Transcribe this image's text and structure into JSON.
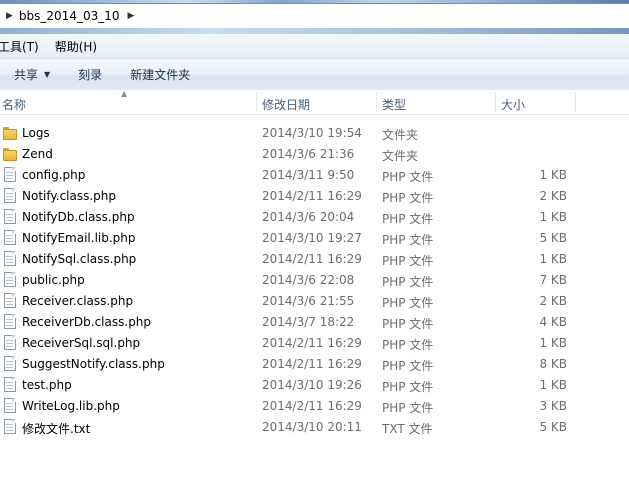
{
  "address": {
    "path": [
      "bbs_2014_03_10"
    ]
  },
  "menu": {
    "items": [
      "工具(T)",
      "帮助(H)"
    ]
  },
  "toolbar": {
    "share": "共享",
    "burn": "刻录",
    "new_folder": "新建文件夹"
  },
  "columns": {
    "name": "名称",
    "date": "修改日期",
    "type": "类型",
    "size": "大小"
  },
  "files": [
    {
      "icon": "folder-icon",
      "name": "Logs",
      "date": "2014/3/10 19:54",
      "type": "文件夹",
      "size": ""
    },
    {
      "icon": "folder-icon",
      "name": "Zend",
      "date": "2014/3/6 21:36",
      "type": "文件夹",
      "size": ""
    },
    {
      "icon": "file-icon",
      "name": "config.php",
      "date": "2014/3/11 9:50",
      "type": "PHP 文件",
      "size": "1 KB"
    },
    {
      "icon": "file-icon",
      "name": "Notify.class.php",
      "date": "2014/2/11 16:29",
      "type": "PHP 文件",
      "size": "2 KB"
    },
    {
      "icon": "file-icon",
      "name": "NotifyDb.class.php",
      "date": "2014/3/6 20:04",
      "type": "PHP 文件",
      "size": "1 KB"
    },
    {
      "icon": "file-icon",
      "name": "NotifyEmail.lib.php",
      "date": "2014/3/10 19:27",
      "type": "PHP 文件",
      "size": "5 KB"
    },
    {
      "icon": "file-icon",
      "name": "NotifySql.class.php",
      "date": "2014/2/11 16:29",
      "type": "PHP 文件",
      "size": "1 KB"
    },
    {
      "icon": "file-icon",
      "name": "public.php",
      "date": "2014/3/6 22:08",
      "type": "PHP 文件",
      "size": "7 KB"
    },
    {
      "icon": "file-icon",
      "name": "Receiver.class.php",
      "date": "2014/3/6 21:55",
      "type": "PHP 文件",
      "size": "2 KB"
    },
    {
      "icon": "file-icon",
      "name": "ReceiverDb.class.php",
      "date": "2014/3/7 18:22",
      "type": "PHP 文件",
      "size": "4 KB"
    },
    {
      "icon": "file-icon",
      "name": "ReceiverSql.sql.php",
      "date": "2014/2/11 16:29",
      "type": "PHP 文件",
      "size": "1 KB"
    },
    {
      "icon": "file-icon",
      "name": "SuggestNotify.class.php",
      "date": "2014/2/11 16:29",
      "type": "PHP 文件",
      "size": "8 KB"
    },
    {
      "icon": "file-icon",
      "name": "test.php",
      "date": "2014/3/10 19:26",
      "type": "PHP 文件",
      "size": "1 KB"
    },
    {
      "icon": "file-icon",
      "name": "WriteLog.lib.php",
      "date": "2014/2/11 16:29",
      "type": "PHP 文件",
      "size": "3 KB"
    },
    {
      "icon": "file-icon",
      "name": "修改文件.txt",
      "date": "2014/3/10 20:11",
      "type": "TXT 文件",
      "size": "5 KB"
    }
  ]
}
